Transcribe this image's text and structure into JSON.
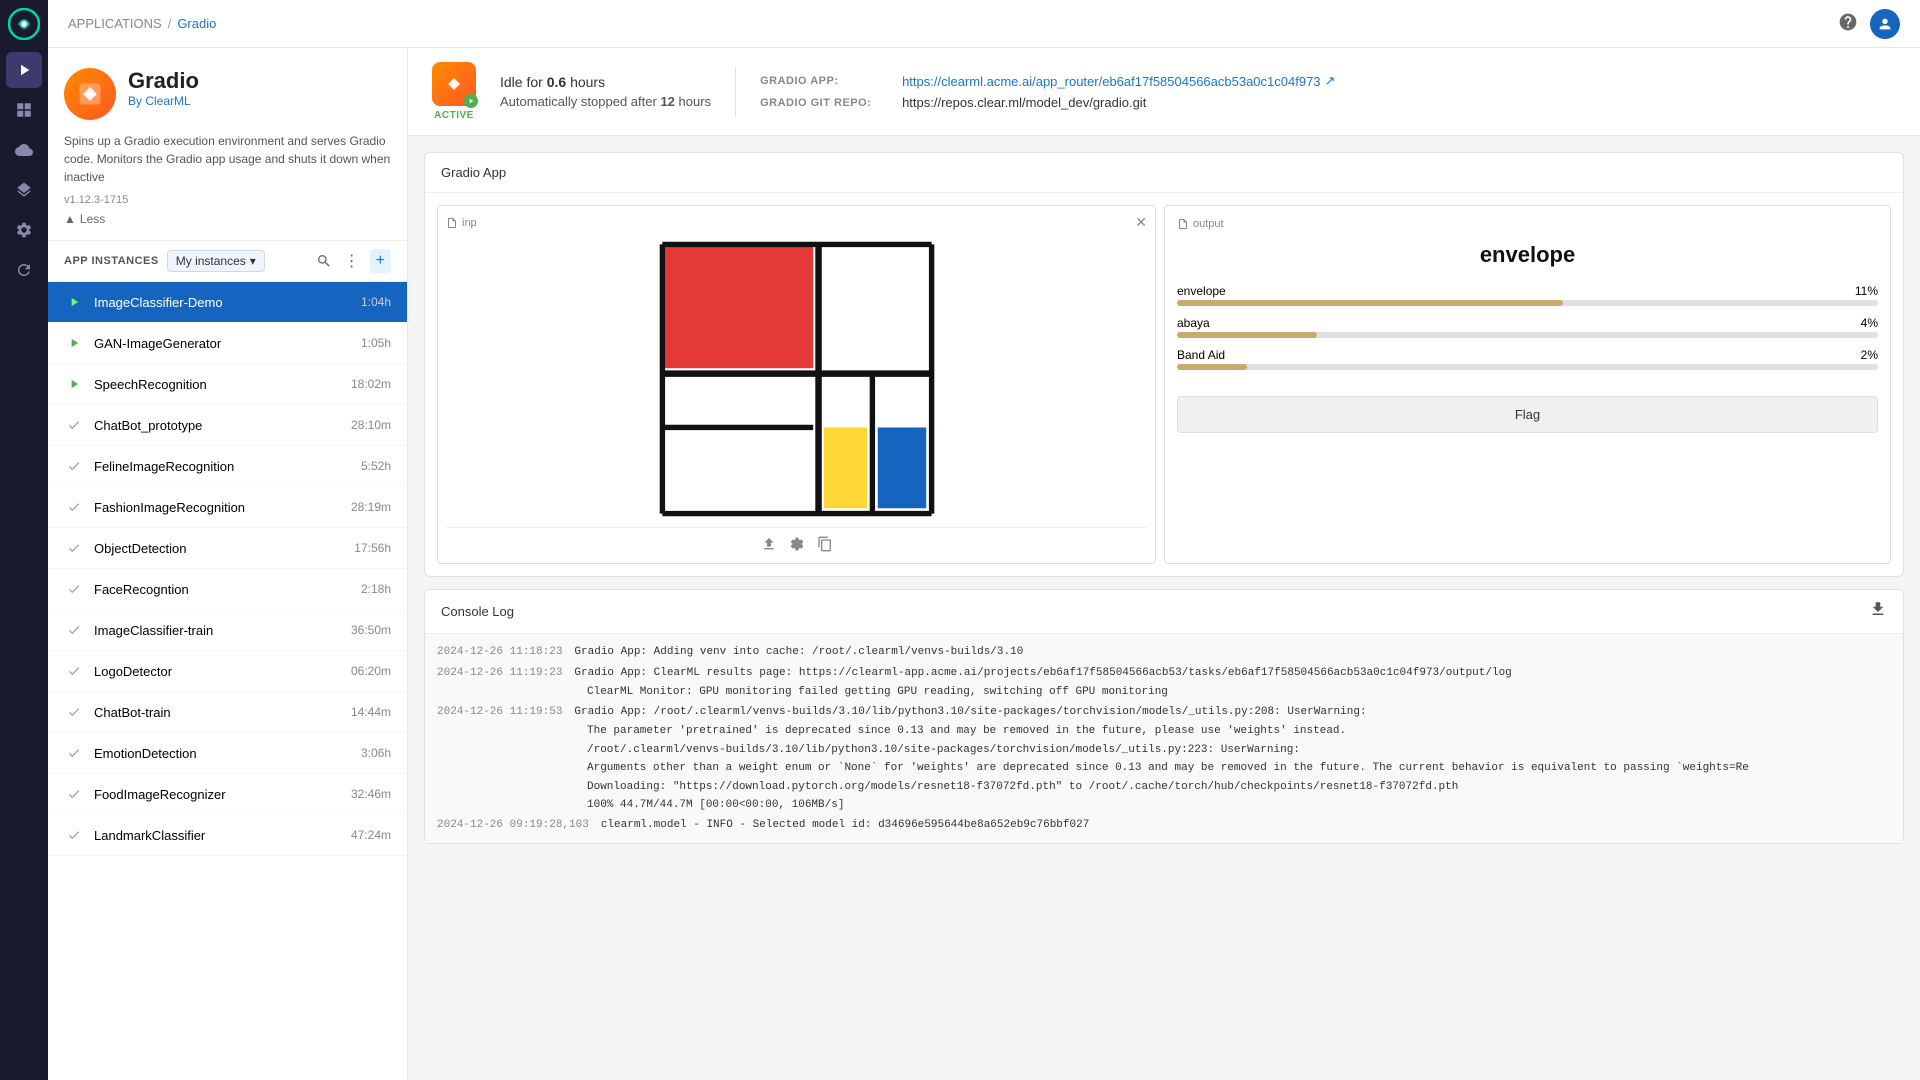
{
  "nav": {
    "logo": "C",
    "breadcrumb_parent": "APPLICATIONS",
    "breadcrumb_current": "Gradio"
  },
  "sidebar": {
    "app_title": "Gradio",
    "app_author": "By ClearML",
    "app_description": "Spins up a Gradio execution environment and serves Gradio code. Monitors the Gradio app usage and shuts it down when inactive",
    "app_version": "v1.12.3-1715",
    "less_btn": "Less",
    "instances_header": "APP INSTANCES",
    "filter_label": "My instances",
    "instances": [
      {
        "name": "ImageClassifier-Demo",
        "time": "1:04h",
        "status": "running",
        "active": true
      },
      {
        "name": "GAN-ImageGenerator",
        "time": "1:05h",
        "status": "running",
        "active": false
      },
      {
        "name": "SpeechRecognition",
        "time": "18:02m",
        "status": "running",
        "active": false
      },
      {
        "name": "ChatBot_prototype",
        "time": "28:10m",
        "status": "stopped",
        "active": false
      },
      {
        "name": "FelineImageRecognition",
        "time": "5:52h",
        "status": "stopped",
        "active": false
      },
      {
        "name": "FashionImageRecognition",
        "time": "28:19m",
        "status": "stopped",
        "active": false
      },
      {
        "name": "ObjectDetection",
        "time": "17:56h",
        "status": "stopped",
        "active": false
      },
      {
        "name": "FaceRecogntion",
        "time": "2:18h",
        "status": "stopped",
        "active": false
      },
      {
        "name": "ImageClassifier-train",
        "time": "36:50m",
        "status": "stopped",
        "active": false
      },
      {
        "name": "LogoDetector",
        "time": "06:20m",
        "status": "stopped",
        "active": false
      },
      {
        "name": "ChatBot-train",
        "time": "14:44m",
        "status": "stopped",
        "active": false
      },
      {
        "name": "EmotionDetection",
        "time": "3:06h",
        "status": "stopped",
        "active": false
      },
      {
        "name": "FoodImageRecognizer",
        "time": "32:46m",
        "status": "stopped",
        "active": false
      },
      {
        "name": "LandmarkClassifier",
        "time": "47:24m",
        "status": "stopped",
        "active": false
      }
    ]
  },
  "status": {
    "idle_prefix": "Idle for",
    "idle_value": "0.6",
    "idle_suffix": "hours",
    "auto_stop_prefix": "Automatically stopped after",
    "auto_stop_value": "12",
    "auto_stop_suffix": "hours",
    "active_label": "ACTIVE",
    "gradio_app_label": "GRADIO APP:",
    "gradio_app_url": "https://clearml.acme.ai/app_router/eb6af17f58504566acb53a0c1c04f973",
    "gradio_git_label": "GRADIO GIT REPO:",
    "gradio_git_url": "https://repos.clear.ml/model_dev/gradio.git"
  },
  "gradio_app": {
    "section_title": "Gradio App",
    "inp_label": "inp",
    "output_label": "output",
    "output_title": "envelope",
    "bars": [
      {
        "label": "envelope",
        "percent": 11,
        "width_pct": 55
      },
      {
        "label": "abaya",
        "percent": 4,
        "width_pct": 20
      },
      {
        "label": "Band Aid",
        "percent": 2,
        "width_pct": 10
      }
    ],
    "flag_btn": "Flag"
  },
  "console": {
    "title": "Console Log",
    "lines": [
      {
        "timestamp": "2024-12-26 11:18:23",
        "text": "Gradio App: Adding venv into cache: /root/.clearml/venvs-builds/3.10"
      },
      {
        "timestamp": "2024-12-26 11:19:23",
        "text": "Gradio App: ClearML results page: https://clearml-app.acme.ai/projects/eb6af17f58504566acb53/tasks/eb6af17f58504566acb53a0c1c04f973/output/log"
      },
      {
        "timestamp": "",
        "text": "ClearML Monitor: GPU monitoring failed getting GPU reading, switching off GPU monitoring"
      },
      {
        "timestamp": "2024-12-26 11:19:53",
        "text": "Gradio App: /root/.clearml/venvs-builds/3.10/lib/python3.10/site-packages/torchvision/models/_utils.py:208: UserWarning:"
      },
      {
        "timestamp": "",
        "text": "The parameter 'pretrained' is deprecated since 0.13 and may be removed in the future, please use 'weights' instead."
      },
      {
        "timestamp": "",
        "text": "/root/.clearml/venvs-builds/3.10/lib/python3.10/site-packages/torchvision/models/_utils.py:223: UserWarning:"
      },
      {
        "timestamp": "",
        "text": "Arguments other than a weight enum or `None` for 'weights' are deprecated since 0.13 and may be removed in the future. The current behavior is equivalent to passing `weights=Re"
      },
      {
        "timestamp": "",
        "text": "Downloading: \"https://download.pytorch.org/models/resnet18-f37072fd.pth\" to /root/.cache/torch/hub/checkpoints/resnet18-f37072fd.pth"
      },
      {
        "timestamp": "",
        "text": "100% 44.7M/44.7M [00:00<00:00, 106MB/s]"
      },
      {
        "timestamp": "2024-12-26 09:19:28,103",
        "text": "clearml.model - INFO - Selected model id: d34696e595644be8a652eb9c76bbf027"
      }
    ]
  }
}
